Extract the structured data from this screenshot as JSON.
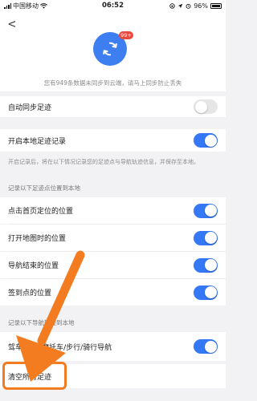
{
  "status_bar": {
    "carrier": "中国移动",
    "time": "06:52",
    "battery": "96%"
  },
  "header": {
    "badge": "99+",
    "sync_note": "您有949条数据未同步到云端，请马上同步防止丢失"
  },
  "settings": {
    "auto_sync": {
      "label": "自动同步足迹",
      "on": false
    },
    "local_record": {
      "label": "开启本地足迹记录",
      "on": true
    },
    "local_record_desc": "开启记录后，将在以下情况记录您的足迹点与导航轨迹信息，并保存至本地。",
    "section_points": "记录以下足迹点位置到本地",
    "points": [
      {
        "label": "点击首页定位的位置",
        "on": true
      },
      {
        "label": "打开地图时的位置",
        "on": true
      },
      {
        "label": "导航结束的位置",
        "on": true
      },
      {
        "label": "签到点的位置",
        "on": true
      }
    ],
    "section_tracks": "记录以下导航轨迹到本地",
    "tracks": {
      "label": "驾车/货车/摩托车/步行/骑行导航",
      "on": true
    },
    "clear_label": "清空所有足迹"
  },
  "colors": {
    "accent": "#3478f6",
    "annotation": "#f47c20",
    "badge": "#ea4a3e"
  }
}
